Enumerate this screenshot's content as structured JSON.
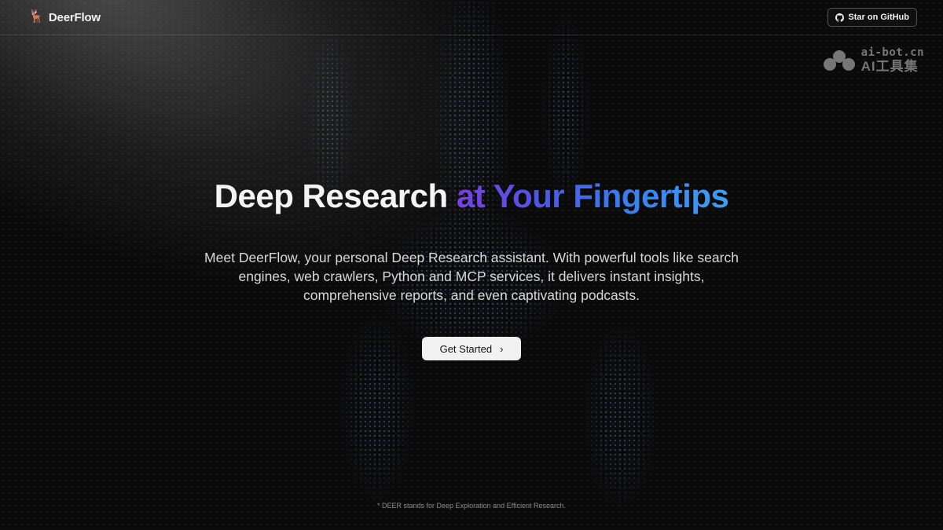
{
  "header": {
    "brand_emoji": "🦌",
    "brand_name": "DeerFlow",
    "github_button_label": "Star on GitHub",
    "github_icon": "github-icon"
  },
  "watermark": {
    "line1": "ai-bot.cn",
    "line2": "AI工具集"
  },
  "hero": {
    "title_plain": "Deep Research",
    "title_gradient": "at Your Fingertips",
    "description": "Meet DeerFlow, your personal Deep Research assistant. With powerful tools like search engines, web crawlers, Python and MCP services, it delivers instant insights, comprehensive reports, and even captivating podcasts.",
    "cta_label": "Get Started",
    "cta_icon": "chevron-right-icon"
  },
  "footer": {
    "note": "* DEER stands for Deep Exploration and Efficient Research."
  },
  "colors": {
    "background": "#0b0b0b",
    "gradient_start": "#7b3fe4",
    "gradient_end": "#3aa0f5",
    "cta_bg": "#f1f1f1"
  }
}
